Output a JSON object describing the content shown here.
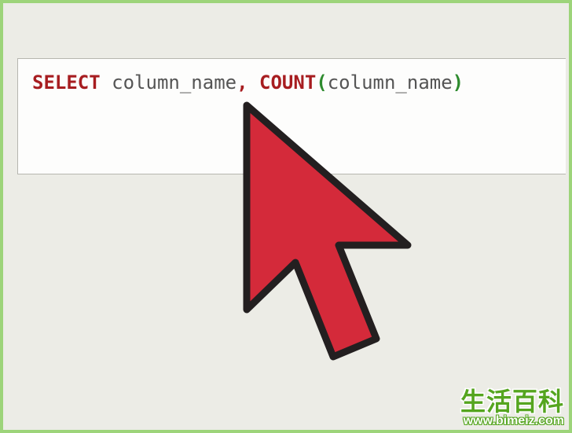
{
  "code": {
    "tokens": [
      {
        "text": "SELECT",
        "cls": "tok-kw"
      },
      {
        "text": " ",
        "cls": ""
      },
      {
        "text": "column_name",
        "cls": "tok-id"
      },
      {
        "text": ",",
        "cls": "tok-punc"
      },
      {
        "text": " ",
        "cls": ""
      },
      {
        "text": "COUNT",
        "cls": "tok-fn"
      },
      {
        "text": "(",
        "cls": "tok-par"
      },
      {
        "text": "column_name",
        "cls": "tok-id"
      },
      {
        "text": ")",
        "cls": "tok-par"
      }
    ]
  },
  "watermark": {
    "brand": "生活百科",
    "url": "www.bimeiz.com"
  }
}
